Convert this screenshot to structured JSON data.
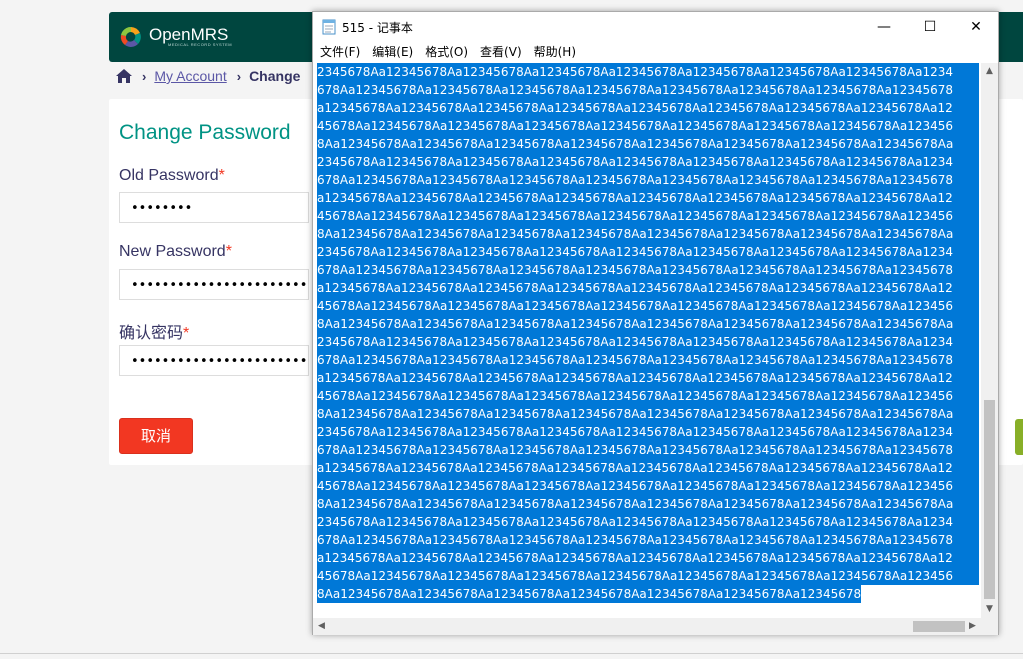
{
  "openmrs": {
    "logo_text": "OpenMRS",
    "logo_subtitle": "MEDICAL RECORD SYSTEM",
    "breadcrumb": {
      "link": "My Account",
      "current": "Change"
    },
    "form": {
      "title": "Change Password",
      "old_password_label": "Old Password",
      "new_password_label": "New Password",
      "confirm_password_label": "确认密码",
      "required_mark": "*",
      "old_password_mask": "••••••••",
      "new_password_mask": "••••••••••••••••••••••••••••",
      "confirm_password_mask": "••••••••••••••••••••••••••••",
      "cancel_label": "取消"
    },
    "colors": {
      "header": "#00463f",
      "title": "#009384",
      "cancel": "#f23722"
    }
  },
  "notepad": {
    "window_title": "515 - 记事本",
    "window_buttons": {
      "minimize": "—",
      "maximize": "☐",
      "close": "✕"
    },
    "menu": [
      "文件(F)",
      "编辑(E)",
      "格式(O)",
      "查看(V)",
      "帮助(H)"
    ],
    "selection_color": "#0078d7",
    "lines": [
      "2345678Aa12345678Aa12345678Aa12345678Aa12345678Aa12345678Aa12345678Aa12345678Aa1234",
      "678Aa12345678Aa12345678Aa12345678Aa12345678Aa12345678Aa12345678Aa12345678Aa12345678",
      "a12345678Aa12345678Aa12345678Aa12345678Aa12345678Aa12345678Aa12345678Aa12345678Aa12",
      "45678Aa12345678Aa12345678Aa12345678Aa12345678Aa12345678Aa12345678Aa12345678Aa123456",
      "8Aa12345678Aa12345678Aa12345678Aa12345678Aa12345678Aa12345678Aa12345678Aa12345678Aa",
      "2345678Aa12345678Aa12345678Aa12345678Aa12345678Aa12345678Aa12345678Aa12345678Aa1234",
      "678Aa12345678Aa12345678Aa12345678Aa12345678Aa12345678Aa12345678Aa12345678Aa12345678",
      "a12345678Aa12345678Aa12345678Aa12345678Aa12345678Aa12345678Aa12345678Aa12345678Aa12",
      "45678Aa12345678Aa12345678Aa12345678Aa12345678Aa12345678Aa12345678Aa12345678Aa123456",
      "8Aa12345678Aa12345678Aa12345678Aa12345678Aa12345678Aa12345678Aa12345678Aa12345678Aa",
      "2345678Aa12345678Aa12345678Aa12345678Aa12345678Aa12345678Aa12345678Aa12345678Aa1234",
      "678Aa12345678Aa12345678Aa12345678Aa12345678Aa12345678Aa12345678Aa12345678Aa12345678",
      "a12345678Aa12345678Aa12345678Aa12345678Aa12345678Aa12345678Aa12345678Aa12345678Aa12",
      "45678Aa12345678Aa12345678Aa12345678Aa12345678Aa12345678Aa12345678Aa12345678Aa123456",
      "8Aa12345678Aa12345678Aa12345678Aa12345678Aa12345678Aa12345678Aa12345678Aa12345678Aa",
      "2345678Aa12345678Aa12345678Aa12345678Aa12345678Aa12345678Aa12345678Aa12345678Aa1234",
      "678Aa12345678Aa12345678Aa12345678Aa12345678Aa12345678Aa12345678Aa12345678Aa12345678",
      "a12345678Aa12345678Aa12345678Aa12345678Aa12345678Aa12345678Aa12345678Aa12345678Aa12",
      "45678Aa12345678Aa12345678Aa12345678Aa12345678Aa12345678Aa12345678Aa12345678Aa123456",
      "8Aa12345678Aa12345678Aa12345678Aa12345678Aa12345678Aa12345678Aa12345678Aa12345678Aa",
      "2345678Aa12345678Aa12345678Aa12345678Aa12345678Aa12345678Aa12345678Aa12345678Aa1234",
      "678Aa12345678Aa12345678Aa12345678Aa12345678Aa12345678Aa12345678Aa12345678Aa12345678",
      "a12345678Aa12345678Aa12345678Aa12345678Aa12345678Aa12345678Aa12345678Aa12345678Aa12",
      "45678Aa12345678Aa12345678Aa12345678Aa12345678Aa12345678Aa12345678Aa12345678Aa123456",
      "8Aa12345678Aa12345678Aa12345678Aa12345678Aa12345678Aa12345678Aa12345678Aa12345678Aa",
      "2345678Aa12345678Aa12345678Aa12345678Aa12345678Aa12345678Aa12345678Aa12345678Aa1234",
      "678Aa12345678Aa12345678Aa12345678Aa12345678Aa12345678Aa12345678Aa12345678Aa12345678",
      "a12345678Aa12345678Aa12345678Aa12345678Aa12345678Aa12345678Aa12345678Aa12345678Aa12",
      "45678Aa12345678Aa12345678Aa12345678Aa12345678Aa12345678Aa12345678Aa12345678Aa123456",
      "8Aa12345678Aa12345678Aa12345678Aa12345678Aa12345678Aa12345678Aa12345678"
    ]
  }
}
